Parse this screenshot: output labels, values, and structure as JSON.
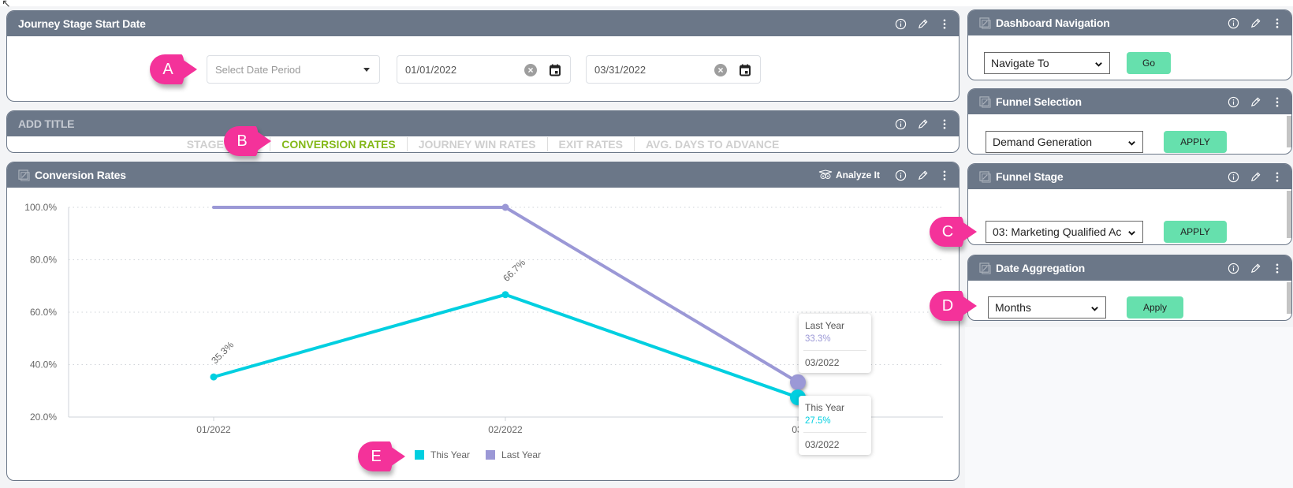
{
  "colors": {
    "header": "#6b7788",
    "accent_green": "#84b819",
    "button_green": "#66e0ad",
    "callout_pink": "#f4329a",
    "series_this_year": "#00cfe0",
    "series_last_year": "#9b98d6"
  },
  "callouts": {
    "a": "A",
    "b": "B",
    "c": "C",
    "d": "D",
    "e": "E"
  },
  "journey_panel": {
    "title": "Journey Stage Start Date",
    "date_period_placeholder": "Select Date Period",
    "start_date": "01/01/2022",
    "end_date": "03/31/2022"
  },
  "tabs_panel": {
    "title": "ADD TITLE",
    "tabs": [
      {
        "label": "STAGE SIZES",
        "active": false
      },
      {
        "label": "CONVERSION RATES",
        "active": true
      },
      {
        "label": "JOURNEY WIN RATES",
        "active": false
      },
      {
        "label": "EXIT RATES",
        "active": false
      },
      {
        "label": "AVG. DAYS TO ADVANCE",
        "active": false
      }
    ]
  },
  "chart_panel": {
    "title": "Conversion Rates",
    "analyze_label": "Analyze It"
  },
  "chart_data": {
    "type": "line",
    "title": "Conversion Rates",
    "xlabel": "",
    "ylabel": "",
    "categories": [
      "01/2022",
      "02/2022",
      "03/2022"
    ],
    "x_tick_labels": [
      "01/2022",
      "02/2022",
      "03/2"
    ],
    "ylim": [
      20,
      100
    ],
    "yticks": [
      100,
      80,
      60,
      40,
      20
    ],
    "ytick_labels": [
      "100.0%",
      "80.0%",
      "60.0%",
      "40.0%",
      "20.0%"
    ],
    "grid": true,
    "legend_position": "bottom",
    "series": [
      {
        "name": "This Year",
        "color": "#00cfe0",
        "values": [
          35.3,
          66.7,
          27.5
        ],
        "data_labels": [
          "35.3%",
          "66.7%",
          null
        ]
      },
      {
        "name": "Last Year",
        "color": "#9b98d6",
        "values": [
          100.0,
          100.0,
          33.3
        ],
        "data_labels": [
          null,
          null,
          null
        ]
      }
    ],
    "tooltips": [
      {
        "series": "Last Year",
        "value": "33.3%",
        "category": "03/2022"
      },
      {
        "series": "This Year",
        "value": "27.5%",
        "category": "03/2022"
      }
    ]
  },
  "legend": {
    "items": [
      "This Year",
      "Last Year"
    ]
  },
  "dashboard_nav": {
    "title": "Dashboard Navigation",
    "select_value": "Navigate To",
    "button": "Go"
  },
  "funnel_selection": {
    "title": "Funnel Selection",
    "select_value": "Demand Generation",
    "button": "APPLY"
  },
  "funnel_stage": {
    "title": "Funnel Stage",
    "select_value": "03: Marketing Qualified Ac",
    "button": "APPLY"
  },
  "date_aggregation": {
    "title": "Date Aggregation",
    "select_value": "Months",
    "button": "Apply"
  }
}
